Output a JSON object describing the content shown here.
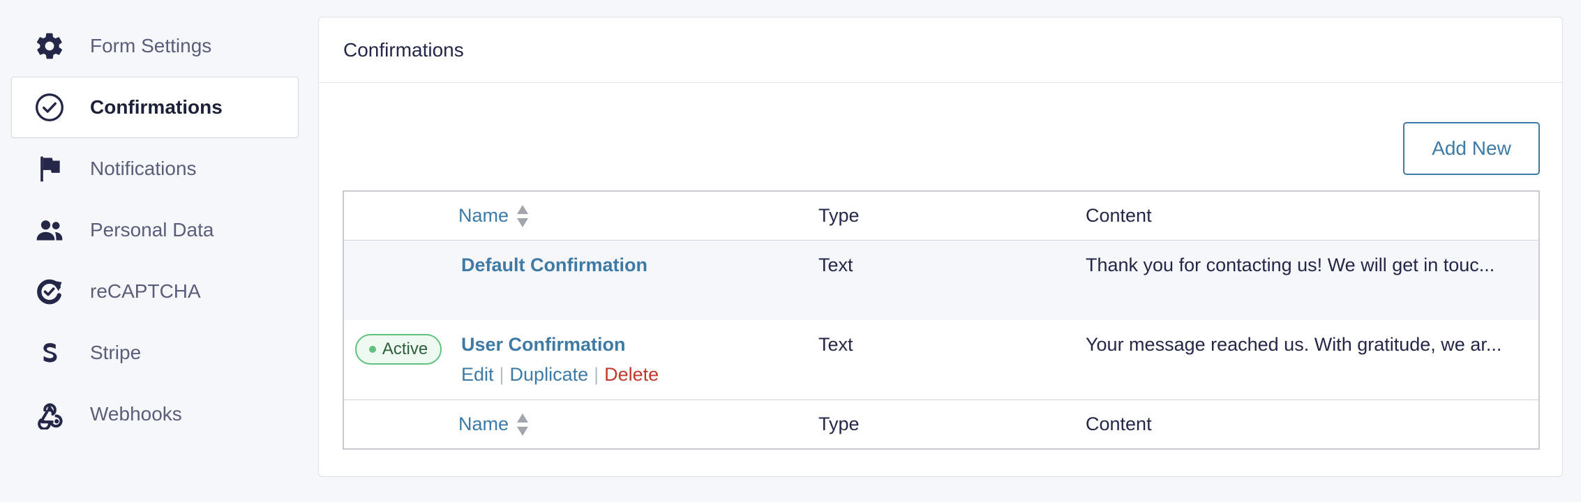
{
  "sidebar": {
    "items": [
      {
        "label": "Form Settings",
        "icon": "gear-icon"
      },
      {
        "label": "Confirmations",
        "icon": "check-circle-icon",
        "active": true
      },
      {
        "label": "Notifications",
        "icon": "flag-icon"
      },
      {
        "label": "Personal Data",
        "icon": "people-icon"
      },
      {
        "label": "reCAPTCHA",
        "icon": "recaptcha-icon"
      },
      {
        "label": "Stripe",
        "icon": "stripe-icon"
      },
      {
        "label": "Webhooks",
        "icon": "webhooks-icon"
      }
    ]
  },
  "panel": {
    "title": "Confirmations",
    "add_new_label": "Add New"
  },
  "table": {
    "columns": {
      "name": "Name",
      "type": "Type",
      "content": "Content"
    },
    "rows": [
      {
        "name": "Default Confirmation",
        "type": "Text",
        "content": "Thank you for contacting us! We will get in touc...",
        "status": ""
      },
      {
        "name": "User Confirmation",
        "type": "Text",
        "content": "Your message reached us. With gratitude, we ar...",
        "status": "Active",
        "actions": {
          "edit": "Edit",
          "duplicate": "Duplicate",
          "delete": "Delete",
          "separator": "|"
        }
      }
    ]
  },
  "colors": {
    "accent": "#3e7aa6",
    "text": "#242748",
    "delete": "#c0392b",
    "active_badge": "#5fc17e",
    "background": "#f6f7fb"
  }
}
